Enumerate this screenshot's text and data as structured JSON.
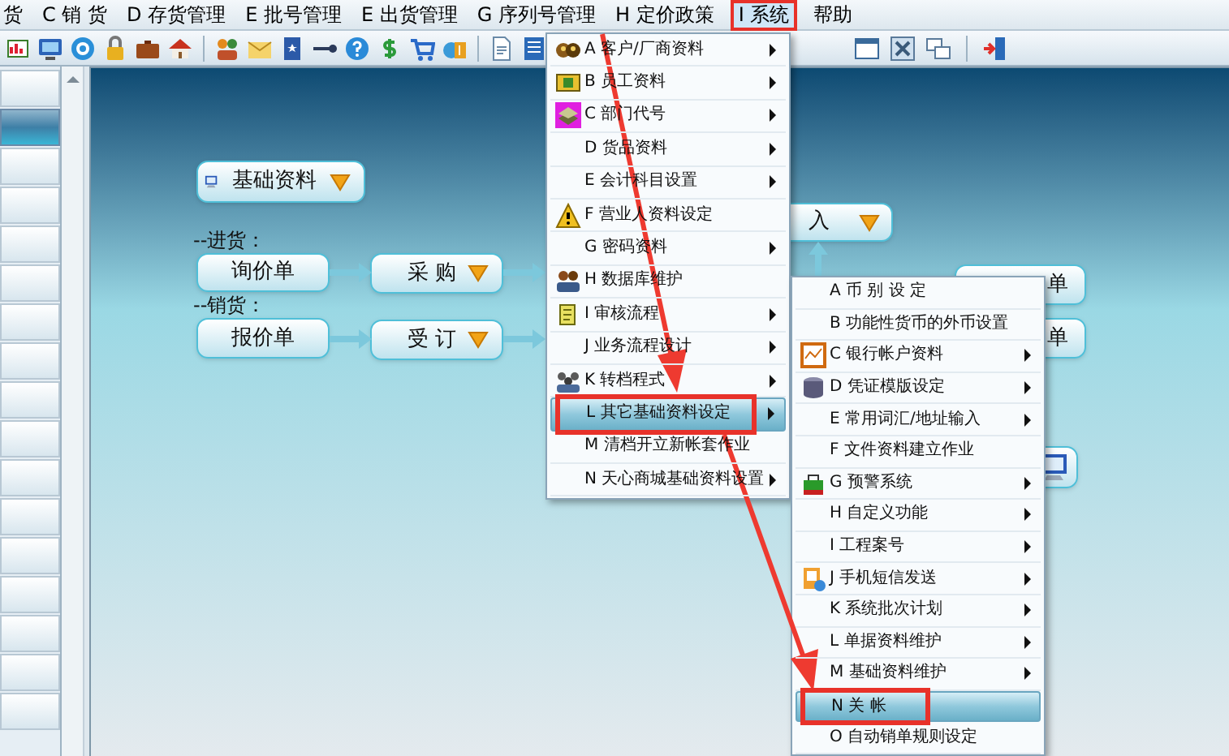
{
  "menu_bar": [
    {
      "label": "货",
      "selected": false
    },
    {
      "label": "C 销 货",
      "selected": false
    },
    {
      "label": "D 存货管理",
      "selected": false
    },
    {
      "label": "E 批号管理",
      "selected": false
    },
    {
      "label": "E 出货管理",
      "selected": false
    },
    {
      "label": "G 序列号管理",
      "selected": false
    },
    {
      "label": "H 定价政策",
      "selected": false
    },
    {
      "label": "I 系统",
      "selected": true
    },
    {
      "label": "帮助",
      "selected": false
    }
  ],
  "sidebar": {
    "items": [
      {
        "selected": false
      },
      {
        "selected": true
      },
      {
        "selected": false
      },
      {
        "selected": false
      },
      {
        "selected": false
      },
      {
        "selected": false
      },
      {
        "selected": false
      },
      {
        "selected": false
      },
      {
        "selected": false
      },
      {
        "selected": false
      },
      {
        "selected": false
      },
      {
        "selected": false
      },
      {
        "selected": false
      },
      {
        "selected": false
      },
      {
        "selected": false
      },
      {
        "selected": false
      },
      {
        "selected": false
      }
    ]
  },
  "flow": {
    "sections": [
      {
        "label": "--进货："
      },
      {
        "label": "--销货："
      }
    ],
    "nodes": [
      {
        "label": "基础资料",
        "kind": "group"
      },
      {
        "label": "询价单",
        "kind": "plain"
      },
      {
        "label": "采 购",
        "kind": "dropdown"
      },
      {
        "label": "报价单",
        "kind": "plain"
      },
      {
        "label": "受 订",
        "kind": "dropdown"
      },
      {
        "label": "入",
        "kind": "dropdown"
      },
      {
        "label": "单",
        "kind": "plain"
      },
      {
        "label": "单",
        "kind": "plain"
      },
      {
        "kind": "icon"
      }
    ]
  },
  "system_menu": {
    "items": [
      {
        "label": "A 客户/厂商资料",
        "has_submenu": true,
        "selected": false
      },
      {
        "label": "B 员工资料",
        "has_submenu": true,
        "selected": false
      },
      {
        "label": "C 部门代号",
        "has_submenu": true,
        "selected": false
      },
      {
        "label": "D 货品资料",
        "has_submenu": true,
        "selected": false
      },
      {
        "label": "E 会计科目设置",
        "has_submenu": true,
        "selected": false
      },
      {
        "label": "F 营业人资料设定",
        "has_submenu": false,
        "selected": false
      },
      {
        "label": "G 密码资料",
        "has_submenu": true,
        "selected": false
      },
      {
        "label": "H 数据库维护",
        "has_submenu": false,
        "selected": false
      },
      {
        "label": "I 审核流程",
        "has_submenu": true,
        "selected": false
      },
      {
        "label": "J 业务流程设计",
        "has_submenu": true,
        "selected": false
      },
      {
        "label": "K 转档程式",
        "has_submenu": true,
        "selected": false
      },
      {
        "label": "L 其它基础资料设定",
        "has_submenu": true,
        "selected": true
      },
      {
        "label": "M 清档开立新帐套作业",
        "has_submenu": false,
        "selected": false
      },
      {
        "label": "N 天心商城基础资料设置",
        "has_submenu": true,
        "selected": false
      }
    ]
  },
  "submenu": {
    "items": [
      {
        "label": "A 币 别 设 定",
        "has_submenu": false,
        "selected": false
      },
      {
        "label": "B 功能性货币的外币设置",
        "has_submenu": false,
        "selected": false
      },
      {
        "label": "C 银行帐户资料",
        "has_submenu": true,
        "selected": false
      },
      {
        "label": "D 凭证模版设定",
        "has_submenu": true,
        "selected": false
      },
      {
        "label": "E 常用词汇/地址输入",
        "has_submenu": true,
        "selected": false
      },
      {
        "label": "F 文件资料建立作业",
        "has_submenu": false,
        "selected": false
      },
      {
        "label": "G 预警系统",
        "has_submenu": true,
        "selected": false
      },
      {
        "label": "H 自定义功能",
        "has_submenu": true,
        "selected": false
      },
      {
        "label": "I 工程案号",
        "has_submenu": true,
        "selected": false
      },
      {
        "label": "J 手机短信发送",
        "has_submenu": true,
        "selected": false
      },
      {
        "label": "K 系统批次计划",
        "has_submenu": true,
        "selected": false
      },
      {
        "label": "L 单据资料维护",
        "has_submenu": true,
        "selected": false
      },
      {
        "label": "M 基础资料维护",
        "has_submenu": true,
        "selected": false
      },
      {
        "label": "N 关 帐",
        "has_submenu": false,
        "selected": true
      },
      {
        "label": "O 自动销单规则设定",
        "has_submenu": false,
        "selected": false
      }
    ]
  }
}
